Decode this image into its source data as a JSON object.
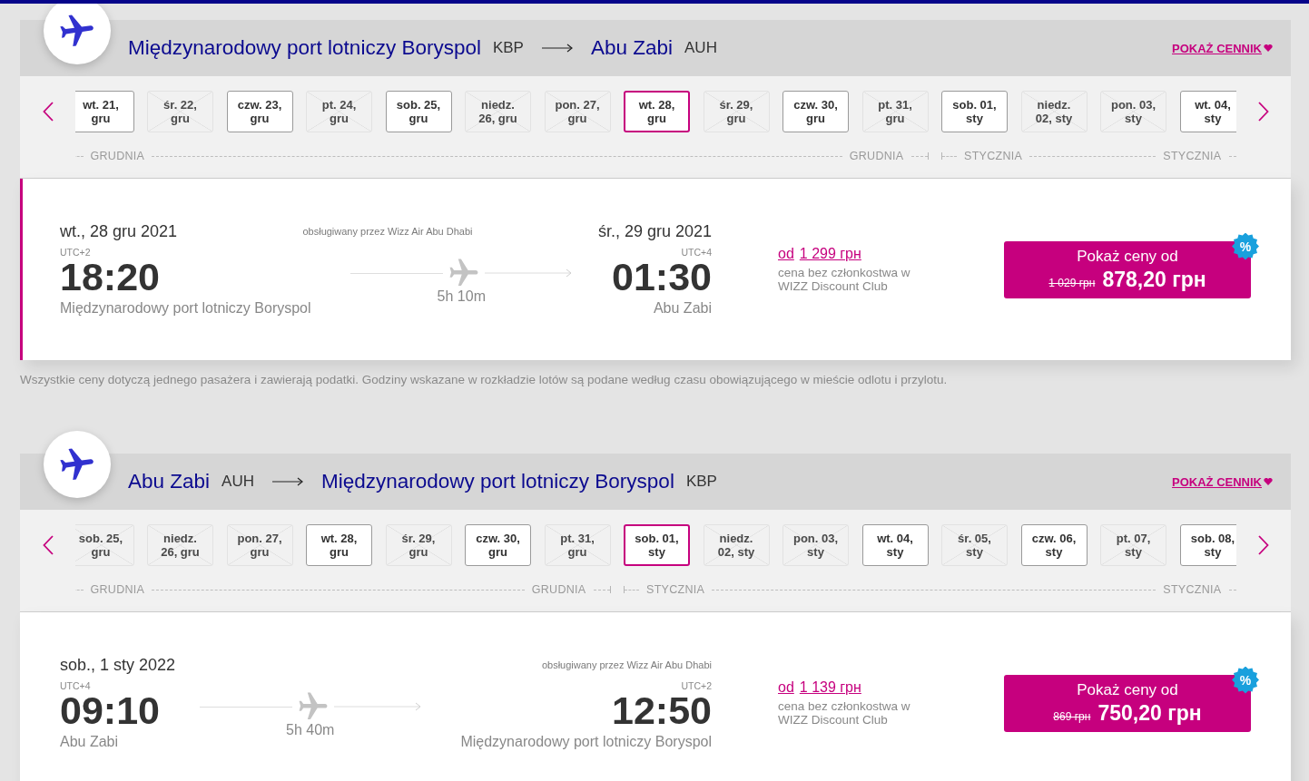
{
  "sections": [
    {
      "route": {
        "origin": {
          "name": "Międzynarodowy port lotniczy Boryspol",
          "code": "KBP"
        },
        "destination": {
          "name": "Abu Zabi",
          "code": "AUH"
        }
      },
      "price_list_link": "POKAŻ CENNIK",
      "months": [
        {
          "start_label": "GRUDNIA",
          "end_label": "GRUDNIA",
          "dates": [
            {
              "lines": [
                "wt. 21,",
                "gru"
              ],
              "available": true,
              "selected": false
            },
            {
              "lines": [
                "śr. 22,",
                "gru"
              ],
              "available": false,
              "selected": false
            },
            {
              "lines": [
                "czw. 23,",
                "gru"
              ],
              "available": true,
              "selected": false
            },
            {
              "lines": [
                "pt. 24,",
                "gru"
              ],
              "available": false,
              "selected": false
            },
            {
              "lines": [
                "sob. 25,",
                "gru"
              ],
              "available": true,
              "selected": false
            },
            {
              "lines": [
                "niedz.",
                "26, gru"
              ],
              "available": false,
              "selected": false
            },
            {
              "lines": [
                "pon. 27,",
                "gru"
              ],
              "available": false,
              "selected": false
            },
            {
              "lines": [
                "wt. 28,",
                "gru"
              ],
              "available": true,
              "selected": true
            },
            {
              "lines": [
                "śr. 29,",
                "gru"
              ],
              "available": false,
              "selected": false
            },
            {
              "lines": [
                "czw. 30,",
                "gru"
              ],
              "available": true,
              "selected": false
            },
            {
              "lines": [
                "pt. 31,",
                "gru"
              ],
              "available": false,
              "selected": false
            }
          ]
        },
        {
          "start_label": "STYCZNIA",
          "end_label": "STYCZNIA",
          "dates": [
            {
              "lines": [
                "sob. 01,",
                "sty"
              ],
              "available": true,
              "selected": false
            },
            {
              "lines": [
                "niedz.",
                "02, sty"
              ],
              "available": false,
              "selected": false
            },
            {
              "lines": [
                "pon. 03,",
                "sty"
              ],
              "available": false,
              "selected": false
            },
            {
              "lines": [
                "wt. 04,",
                "sty"
              ],
              "available": true,
              "selected": false
            }
          ]
        }
      ],
      "flight": {
        "selected": true,
        "operator_note": "obsługiwany przez Wizz Air Abu Dhabi",
        "departure": {
          "date": "wt., 28 gru 2021",
          "utc": "UTC+2",
          "time": "18:20",
          "city": "Międzynarodowy port lotniczy Boryspol"
        },
        "duration": "5h 10m",
        "arrival": {
          "date": "śr., 29 gru 2021",
          "utc": "UTC+4",
          "time": "01:30",
          "city": "Abu Zabi"
        },
        "regular_price": {
          "prefix": "od",
          "amount": "1 299 грн",
          "caption": "cena bez członkostwa w WIZZ Discount Club"
        },
        "price_button": {
          "label": "Pokaż ceny od",
          "old_price": "1 029 грн",
          "price": "878,20 грн",
          "badge": "%"
        }
      },
      "note": "Wszystkie ceny dotyczą jednego pasażera i zawierają podatki. Godziny wskazane w rozkładzie lotów są podane według czasu obowiązującego w mieście odlotu i przylotu."
    },
    {
      "route": {
        "origin": {
          "name": "Abu Zabi",
          "code": "AUH"
        },
        "destination": {
          "name": "Międzynarodowy port lotniczy Boryspol",
          "code": "KBP"
        }
      },
      "price_list_link": "POKAŻ CENNIK",
      "months": [
        {
          "start_label": "GRUDNIA",
          "end_label": "GRUDNIA",
          "dates": [
            {
              "lines": [
                "sob. 25,",
                "gru"
              ],
              "available": false,
              "selected": false
            },
            {
              "lines": [
                "niedz.",
                "26, gru"
              ],
              "available": false,
              "selected": false
            },
            {
              "lines": [
                "pon. 27,",
                "gru"
              ],
              "available": false,
              "selected": false
            },
            {
              "lines": [
                "wt. 28,",
                "gru"
              ],
              "available": true,
              "selected": false
            },
            {
              "lines": [
                "śr. 29,",
                "gru"
              ],
              "available": false,
              "selected": false
            },
            {
              "lines": [
                "czw. 30,",
                "gru"
              ],
              "available": true,
              "selected": false
            },
            {
              "lines": [
                "pt. 31,",
                "gru"
              ],
              "available": false,
              "selected": false
            }
          ]
        },
        {
          "start_label": "STYCZNIA",
          "end_label": "STYCZNIA",
          "dates": [
            {
              "lines": [
                "sob. 01,",
                "sty"
              ],
              "available": true,
              "selected": true
            },
            {
              "lines": [
                "niedz.",
                "02, sty"
              ],
              "available": false,
              "selected": false
            },
            {
              "lines": [
                "pon. 03,",
                "sty"
              ],
              "available": false,
              "selected": false
            },
            {
              "lines": [
                "wt. 04,",
                "sty"
              ],
              "available": true,
              "selected": false
            },
            {
              "lines": [
                "śr. 05,",
                "sty"
              ],
              "available": false,
              "selected": false
            },
            {
              "lines": [
                "czw. 06,",
                "sty"
              ],
              "available": true,
              "selected": false
            },
            {
              "lines": [
                "pt. 07,",
                "sty"
              ],
              "available": false,
              "selected": false
            },
            {
              "lines": [
                "sob. 08,",
                "sty"
              ],
              "available": true,
              "selected": false
            }
          ]
        }
      ],
      "flight": {
        "selected": false,
        "operator_note": "obsługiwany przez Wizz Air Abu Dhabi",
        "departure": {
          "date": "sob., 1 sty 2022",
          "utc": "UTC+4",
          "time": "09:10",
          "city": "Abu Zabi"
        },
        "duration": "5h 40m",
        "arrival": {
          "utc": "UTC+2",
          "time": "12:50",
          "city": "Międzynarodowy port lotniczy Boryspol"
        },
        "regular_price": {
          "prefix": "od",
          "amount": "1 139 грн",
          "caption": "cena bez członkostwa w WIZZ Discount Club"
        },
        "price_button": {
          "label": "Pokaż ceny od",
          "old_price": "869 грн",
          "price": "750,20 грн",
          "badge": "%"
        }
      }
    }
  ]
}
